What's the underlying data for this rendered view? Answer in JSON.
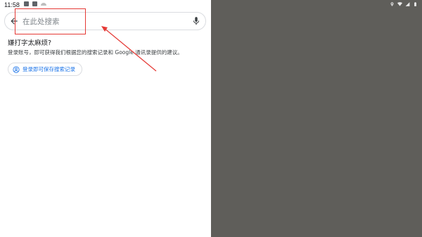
{
  "status_bar": {
    "time": "11:58"
  },
  "search": {
    "placeholder": "在此处搜索",
    "value": ""
  },
  "promo": {
    "title": "嫌打字太麻烦?",
    "description": "登录账号，即可获得我们根据您的搜索记录和 Google 通讯录提供的建议。",
    "login_chip_label": "登录即可保存搜索记录"
  },
  "colors": {
    "accent": "#1a73e8",
    "annotation_red": "#e53935",
    "right_pane_bg": "#5f5e5a"
  },
  "icons": {
    "back": "arrow-back-icon",
    "mic": "mic-icon",
    "account": "account-circle-icon"
  }
}
